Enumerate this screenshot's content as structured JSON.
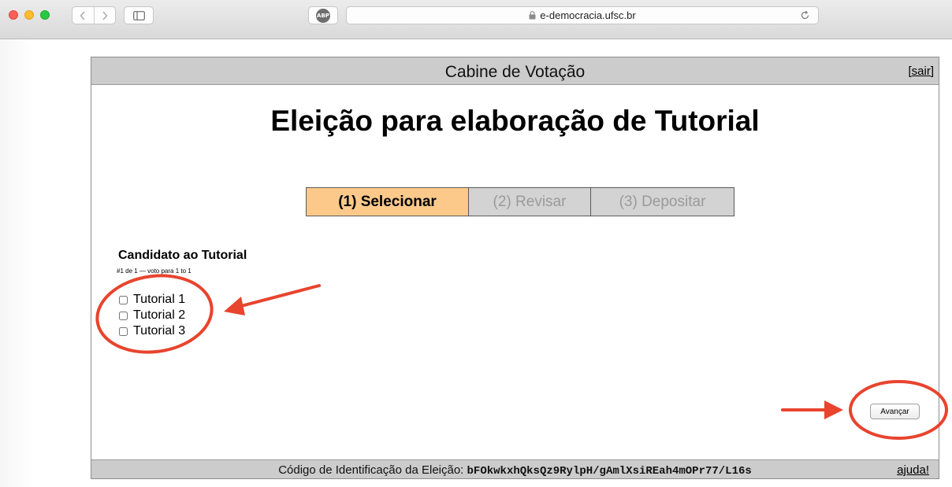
{
  "browser": {
    "url": "e-democracia.ufsc.br",
    "adblock_label": "ABP"
  },
  "booth": {
    "title": "Cabine de Votação",
    "logout_label": "[sair]",
    "election_title": "Eleição para elaboração de Tutorial",
    "steps": [
      {
        "label": "(1) Selecionar",
        "active": true
      },
      {
        "label": "(2) Revisar",
        "active": false
      },
      {
        "label": "(3) Depositar",
        "active": false
      }
    ],
    "question": {
      "title": "Candidato ao Tutorial",
      "info": "#1 de 1 — voto para 1 to 1",
      "options": [
        "Tutorial 1",
        "Tutorial 2",
        "Tutorial 3"
      ]
    },
    "next_button": "Avançar",
    "footer": {
      "label": "Código de Identificação da Eleição:",
      "code": "bFOkwkxhQksQz9RylpH/gAmlXsiREah4mOPr77/L16s",
      "help_label": "ajuda!"
    }
  },
  "colors": {
    "annotation": "#e8442e",
    "active_step": "#fcc98b",
    "header_bg": "#cccccc"
  }
}
